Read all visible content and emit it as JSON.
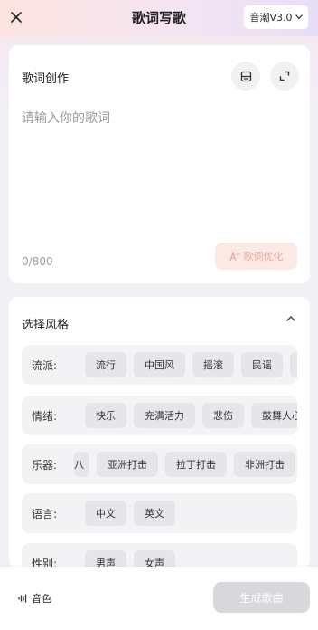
{
  "header": {
    "title": "歌词写歌",
    "model_selector": "音潮V3.0"
  },
  "lyrics": {
    "section_title": "歌词创作",
    "placeholder": "请输入你的歌词",
    "value": "",
    "counter": "0/800",
    "optimize_label": "歌词优化"
  },
  "style": {
    "section_title": "选择风格",
    "rows": [
      {
        "label": "流派:",
        "options": [
          "流行",
          "中国风",
          "摇滚",
          "民谣",
          "R"
        ]
      },
      {
        "label": "情绪:",
        "options": [
          "快乐",
          "充满活力",
          "悲伤",
          "鼓舞人心"
        ]
      },
      {
        "label": "乐器:",
        "options": [
          "八",
          "亚洲打击",
          "拉丁打击",
          "非洲打击"
        ]
      },
      {
        "label": "语言:",
        "options": [
          "中文",
          "英文"
        ]
      },
      {
        "label": "性别:",
        "options": [
          "男声",
          "女声"
        ]
      }
    ]
  },
  "bottom": {
    "voice_label": "音色",
    "generate_label": "生成歌曲"
  }
}
